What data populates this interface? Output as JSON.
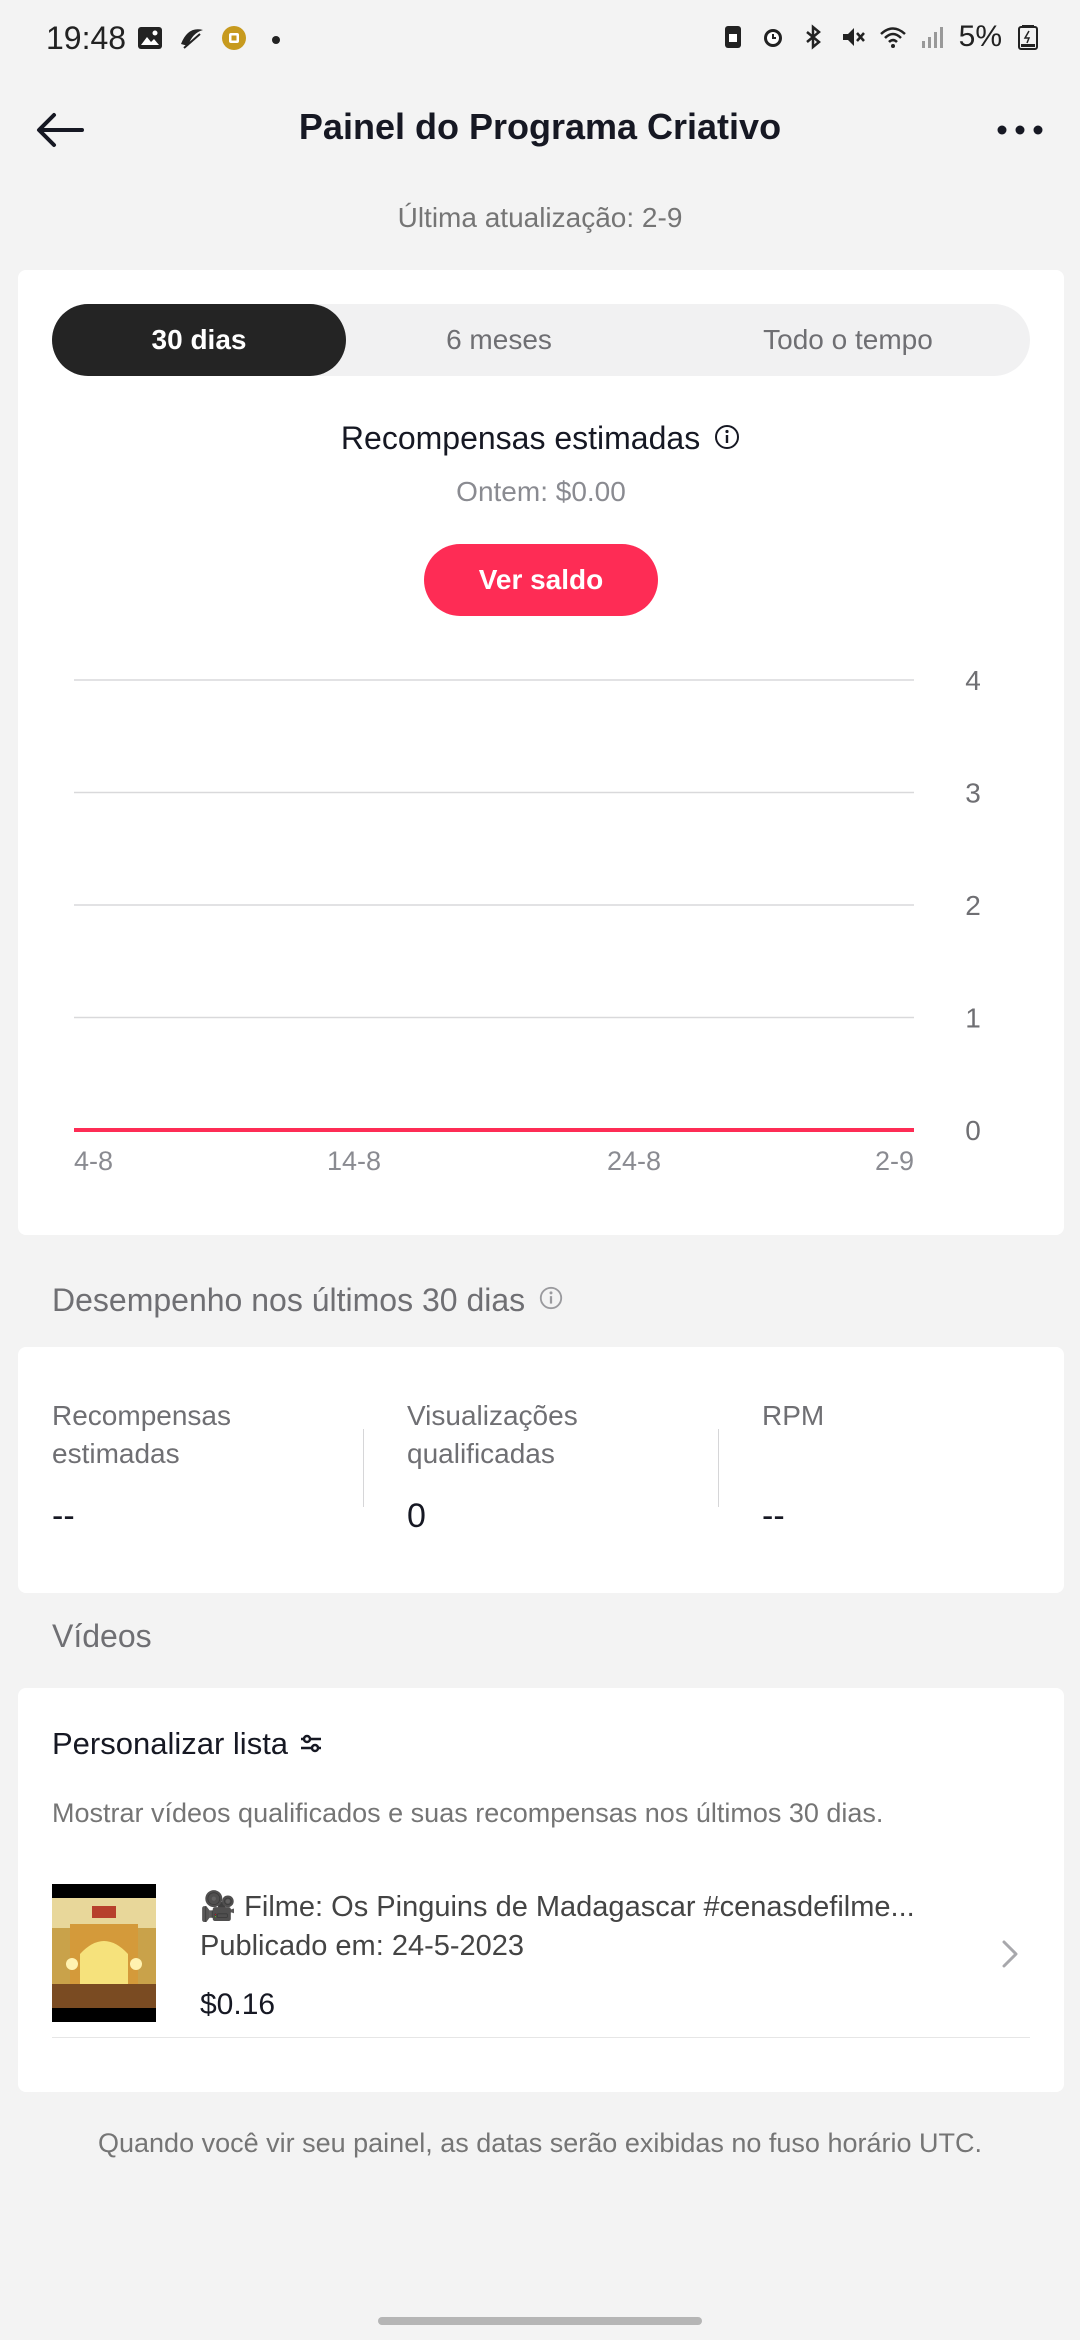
{
  "status_bar": {
    "time": "19:48",
    "battery": "5%"
  },
  "header": {
    "title": "Painel do Programa Criativo"
  },
  "last_update": "Última atualização: 2-9",
  "tabs": [
    {
      "label": "30 dias",
      "active": true
    },
    {
      "label": "6 meses",
      "active": false
    },
    {
      "label": "Todo o tempo",
      "active": false
    }
  ],
  "rewards": {
    "title": "Recompensas estimadas",
    "yesterday": "Ontem: $0.00",
    "button": "Ver saldo"
  },
  "chart_data": {
    "type": "line",
    "x": [
      "4-8",
      "14-8",
      "24-8",
      "2-9"
    ],
    "y_ticks": [
      "4",
      "3",
      "2",
      "1",
      "0"
    ],
    "ylim": [
      0,
      4
    ],
    "series": [
      {
        "values": [
          0,
          0,
          0,
          0
        ],
        "color": "#fe2c55"
      }
    ],
    "grid": true
  },
  "performance": {
    "section_label": "Desempenho nos últimos 30 dias",
    "metrics": [
      {
        "label_line1": "Recompensas",
        "label_line2": "estimadas",
        "value": "--"
      },
      {
        "label_line1": "Visualizações",
        "label_line2": "qualificadas",
        "value": "0"
      },
      {
        "label_line1": "RPM",
        "label_line2": "",
        "value": "--"
      }
    ]
  },
  "videos": {
    "section_label": "Vídeos",
    "customize": "Personalizar lista",
    "description": "Mostrar vídeos qualificados e suas recompensas nos últimos 30 dias.",
    "items": [
      {
        "title": "🎥 Filme: Os Pinguins de Madagascar #cenasdefilme...",
        "published": "Publicado em: 24-5-2023",
        "reward": "$0.16"
      }
    ]
  },
  "footer": "Quando você vir seu painel, as datas serão exibidas no fuso horário UTC.",
  "colors": {
    "accent": "#fe2c55",
    "active_tab": "#242424",
    "background": "#f3f3f3"
  }
}
